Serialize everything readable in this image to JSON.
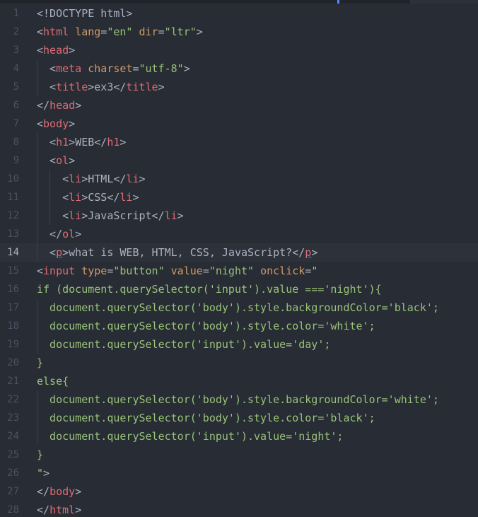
{
  "editor": {
    "language": "html",
    "current_line": 14,
    "colors": {
      "background": "#282c34",
      "gutter": "#495162",
      "tag": "#e06c75",
      "attribute": "#d19a66",
      "string": "#98c379",
      "plain": "#abb2bf",
      "current_line": "#2c313a"
    },
    "lines": [
      {
        "n": "1",
        "indent": 0,
        "tokens": [
          [
            "tk-punct",
            "<!DOCTYPE html>"
          ]
        ]
      },
      {
        "n": "2",
        "indent": 0,
        "tokens": [
          [
            "tk-punct",
            "<"
          ],
          [
            "tk-tag",
            "html"
          ],
          [
            "tk-plain",
            " "
          ],
          [
            "tk-attr",
            "lang"
          ],
          [
            "tk-punct",
            "="
          ],
          [
            "tk-str",
            "\"en\""
          ],
          [
            "tk-plain",
            " "
          ],
          [
            "tk-attr",
            "dir"
          ],
          [
            "tk-punct",
            "="
          ],
          [
            "tk-str",
            "\"ltr\""
          ],
          [
            "tk-punct",
            ">"
          ]
        ]
      },
      {
        "n": "3",
        "indent": 0,
        "tokens": [
          [
            "tk-punct",
            "<"
          ],
          [
            "tk-tag",
            "head"
          ],
          [
            "tk-punct",
            ">"
          ]
        ]
      },
      {
        "n": "4",
        "indent": 1,
        "tokens": [
          [
            "tk-punct",
            "<"
          ],
          [
            "tk-tag",
            "meta"
          ],
          [
            "tk-plain",
            " "
          ],
          [
            "tk-attr",
            "charset"
          ],
          [
            "tk-punct",
            "="
          ],
          [
            "tk-str",
            "\"utf-8\""
          ],
          [
            "tk-punct",
            ">"
          ]
        ]
      },
      {
        "n": "5",
        "indent": 1,
        "tokens": [
          [
            "tk-punct",
            "<"
          ],
          [
            "tk-tag",
            "title"
          ],
          [
            "tk-punct",
            ">"
          ],
          [
            "tk-plain",
            "ex3"
          ],
          [
            "tk-punct",
            "</"
          ],
          [
            "tk-tag",
            "title"
          ],
          [
            "tk-punct",
            ">"
          ]
        ]
      },
      {
        "n": "6",
        "indent": 0,
        "tokens": [
          [
            "tk-punct",
            "</"
          ],
          [
            "tk-tag",
            "head"
          ],
          [
            "tk-punct",
            ">"
          ]
        ]
      },
      {
        "n": "7",
        "indent": 0,
        "tokens": [
          [
            "tk-punct",
            "<"
          ],
          [
            "tk-tag",
            "body"
          ],
          [
            "tk-punct",
            ">"
          ]
        ]
      },
      {
        "n": "8",
        "indent": 1,
        "tokens": [
          [
            "tk-punct",
            "<"
          ],
          [
            "tk-tag",
            "h1"
          ],
          [
            "tk-punct",
            ">"
          ],
          [
            "tk-plain",
            "WEB"
          ],
          [
            "tk-punct",
            "</"
          ],
          [
            "tk-tag",
            "h1"
          ],
          [
            "tk-punct",
            ">"
          ]
        ]
      },
      {
        "n": "9",
        "indent": 1,
        "tokens": [
          [
            "tk-punct",
            "<"
          ],
          [
            "tk-tag",
            "ol"
          ],
          [
            "tk-punct",
            ">"
          ]
        ]
      },
      {
        "n": "10",
        "indent": 2,
        "tokens": [
          [
            "tk-punct",
            "<"
          ],
          [
            "tk-tag",
            "li"
          ],
          [
            "tk-punct",
            ">"
          ],
          [
            "tk-plain",
            "HTML"
          ],
          [
            "tk-punct",
            "</"
          ],
          [
            "tk-tag",
            "li"
          ],
          [
            "tk-punct",
            ">"
          ]
        ]
      },
      {
        "n": "11",
        "indent": 2,
        "tokens": [
          [
            "tk-punct",
            "<"
          ],
          [
            "tk-tag",
            "li"
          ],
          [
            "tk-punct",
            ">"
          ],
          [
            "tk-plain",
            "CSS"
          ],
          [
            "tk-punct",
            "</"
          ],
          [
            "tk-tag",
            "li"
          ],
          [
            "tk-punct",
            ">"
          ]
        ]
      },
      {
        "n": "12",
        "indent": 2,
        "tokens": [
          [
            "tk-punct",
            "<"
          ],
          [
            "tk-tag",
            "li"
          ],
          [
            "tk-punct",
            ">"
          ],
          [
            "tk-plain",
            "JavaScript"
          ],
          [
            "tk-punct",
            "</"
          ],
          [
            "tk-tag",
            "li"
          ],
          [
            "tk-punct",
            ">"
          ]
        ]
      },
      {
        "n": "13",
        "indent": 1,
        "tokens": [
          [
            "tk-punct",
            "</"
          ],
          [
            "tk-tag",
            "ol"
          ],
          [
            "tk-punct",
            ">"
          ]
        ]
      },
      {
        "n": "14",
        "indent": 1,
        "tokens": [
          [
            "tk-punct",
            "<"
          ],
          [
            "tk-tag tk-under",
            "p"
          ],
          [
            "tk-punct",
            ">"
          ],
          [
            "tk-plain",
            "what is WEB, HTML, CSS, JavaScript?"
          ],
          [
            "tk-punct",
            "</"
          ],
          [
            "tk-tag tk-under",
            "p"
          ],
          [
            "tk-punct",
            ">"
          ]
        ]
      },
      {
        "n": "15",
        "indent": 0,
        "tokens": [
          [
            "tk-punct",
            "<"
          ],
          [
            "tk-tag",
            "input"
          ],
          [
            "tk-plain",
            " "
          ],
          [
            "tk-attr",
            "type"
          ],
          [
            "tk-punct",
            "="
          ],
          [
            "tk-str",
            "\"button\""
          ],
          [
            "tk-plain",
            " "
          ],
          [
            "tk-attr",
            "value"
          ],
          [
            "tk-punct",
            "="
          ],
          [
            "tk-str",
            "\"night\""
          ],
          [
            "tk-plain",
            " "
          ],
          [
            "tk-attr",
            "onclick"
          ],
          [
            "tk-punct",
            "="
          ],
          [
            "tk-str",
            "\""
          ]
        ]
      },
      {
        "n": "16",
        "indent": 0,
        "tokens": [
          [
            "tk-str",
            "if (document.querySelector('input').value ==='night'){"
          ]
        ]
      },
      {
        "n": "17",
        "indent": 1,
        "tokens": [
          [
            "tk-str",
            "document.querySelector('body').style.backgroundColor='black';"
          ]
        ]
      },
      {
        "n": "18",
        "indent": 1,
        "tokens": [
          [
            "tk-str",
            "document.querySelector('body').style.color='white';"
          ]
        ]
      },
      {
        "n": "19",
        "indent": 1,
        "tokens": [
          [
            "tk-str",
            "document.querySelector('input').value='day';"
          ]
        ]
      },
      {
        "n": "20",
        "indent": 0,
        "tokens": [
          [
            "tk-str",
            "}"
          ]
        ]
      },
      {
        "n": "21",
        "indent": 0,
        "tokens": [
          [
            "tk-str",
            "else{"
          ]
        ]
      },
      {
        "n": "22",
        "indent": 1,
        "tokens": [
          [
            "tk-str",
            "document.querySelector('body').style.backgroundColor='white';"
          ]
        ]
      },
      {
        "n": "23",
        "indent": 1,
        "tokens": [
          [
            "tk-str",
            "document.querySelector('body').style.color='black';"
          ]
        ]
      },
      {
        "n": "24",
        "indent": 1,
        "tokens": [
          [
            "tk-str",
            "document.querySelector('input').value='night';"
          ]
        ]
      },
      {
        "n": "25",
        "indent": 0,
        "tokens": [
          [
            "tk-str",
            "}"
          ]
        ]
      },
      {
        "n": "26",
        "indent": 0,
        "tokens": [
          [
            "tk-str",
            "\""
          ],
          [
            "tk-punct",
            ">"
          ]
        ]
      },
      {
        "n": "27",
        "indent": 0,
        "tokens": [
          [
            "tk-punct",
            "</"
          ],
          [
            "tk-tag",
            "body"
          ],
          [
            "tk-punct",
            ">"
          ]
        ]
      },
      {
        "n": "28",
        "indent": 0,
        "tokens": [
          [
            "tk-punct",
            "</"
          ],
          [
            "tk-tag",
            "html"
          ],
          [
            "tk-punct",
            ">"
          ]
        ]
      }
    ]
  }
}
